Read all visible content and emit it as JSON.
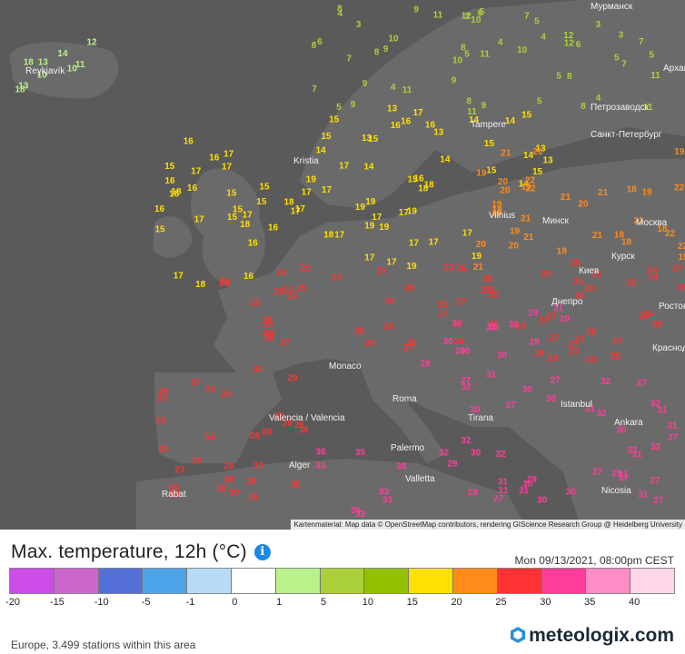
{
  "map": {
    "region": "Europe",
    "attribution": "Kartenmaterial: Map data © OpenStreetMap contributors, rendering GIScience Research Group @ Heidelberg University",
    "cities": [
      "Reykjavík",
      "Tampere",
      "Kristia",
      "Мурманск",
      "Архан",
      "Петрозаводск",
      "Санкт-Петербург",
      "Vilnius",
      "Минск",
      "Москва",
      "Киев",
      "Курск",
      "Ростов",
      "Днепро",
      "Краснод",
      "Monaco",
      "Valencia / Valencia",
      "Alger",
      "Rabat",
      "Palermo",
      "Valletta",
      "Tirana",
      "Istanbul",
      "Ankara",
      "Nicosia",
      "Roma"
    ],
    "colors": {
      "land": "#5a5a5a",
      "sea": "#505050"
    }
  },
  "header": {
    "title": "Max. temperature, 12h (°C)",
    "info_icon": "i",
    "timestamp": "Mon 09/13/2021, 08:00pm CEST"
  },
  "scale": {
    "colors": [
      "#cc4de8",
      "#cc66cc",
      "#5470d6",
      "#4da3e8",
      "#b8dcf7",
      "#ffffff",
      "#b9f28a",
      "#acd03a",
      "#93c000",
      "#ffe000",
      "#ff8c1a",
      "#ff3333",
      "#ff3d9a",
      "#ff8cc6",
      "#ffd6e8"
    ],
    "ticks": [
      "-20",
      "-15",
      "-10",
      "-5",
      "-1",
      "0",
      "1",
      "5",
      "10",
      "15",
      "20",
      "25",
      "30",
      "35",
      "40"
    ]
  },
  "footer": {
    "stations_text": "Europe, 3.499 stations within this area",
    "brand": "meteologix.com"
  },
  "icons": {
    "info": "info-icon",
    "brand": "meteologix-logo-icon"
  }
}
